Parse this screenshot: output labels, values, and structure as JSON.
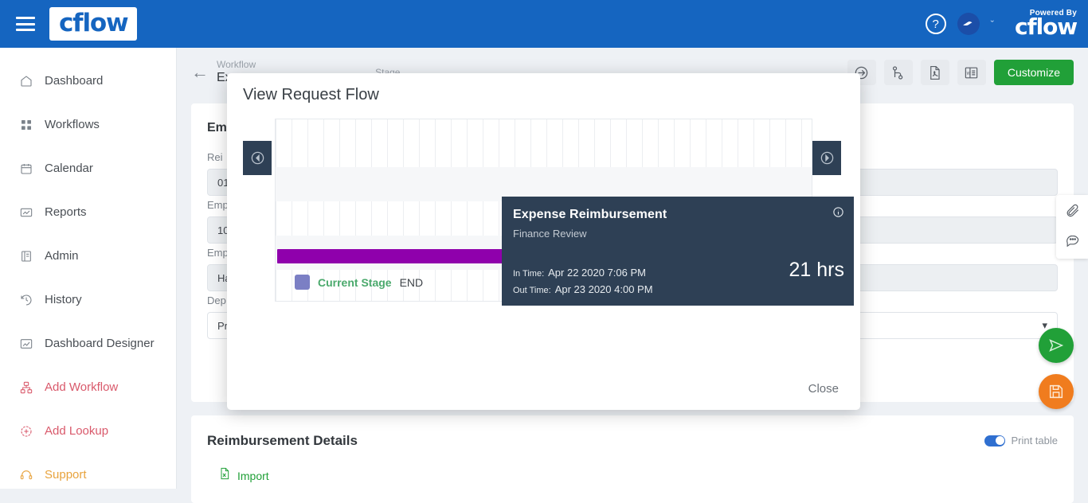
{
  "topbar": {
    "logo_text": "cflow",
    "help_icon": "question-circle-icon",
    "caret": "ˇ",
    "powered_by": "Powered By",
    "powered_logo": "cflow"
  },
  "sidebar": {
    "items": [
      {
        "label": "Dashboard",
        "icon": "home-icon",
        "tone": ""
      },
      {
        "label": "Workflows",
        "icon": "grid-icon",
        "tone": ""
      },
      {
        "label": "Calendar",
        "icon": "calendar-icon",
        "tone": ""
      },
      {
        "label": "Reports",
        "icon": "report-icon",
        "tone": ""
      },
      {
        "label": "Admin",
        "icon": "book-icon",
        "tone": ""
      },
      {
        "label": "History",
        "icon": "clock-history-icon",
        "tone": ""
      },
      {
        "label": "Dashboard Designer",
        "icon": "designer-icon",
        "tone": ""
      },
      {
        "label": "Add Workflow",
        "icon": "add-workflow-icon",
        "tone": "red"
      },
      {
        "label": "Add Lookup",
        "icon": "add-lookup-icon",
        "tone": "red"
      },
      {
        "label": "Support",
        "icon": "headset-icon",
        "tone": "orange"
      }
    ]
  },
  "breadcrumb": {
    "back_icon": "back-arrow-icon",
    "workflow_label": "Workflow",
    "workflow_value": "Exp",
    "stage_label": "Stage",
    "stage_value": ""
  },
  "toolbar": {
    "buttons": [
      {
        "icon": "arrow-in-circle-icon"
      },
      {
        "icon": "branch-icon"
      },
      {
        "icon": "pdf-file-icon"
      },
      {
        "icon": "word-file-icon"
      }
    ],
    "customize_label": "Customize"
  },
  "form": {
    "heading": "Em",
    "fields": [
      {
        "label": "Rei",
        "value": "01"
      },
      {
        "label": "Emp",
        "value": "10"
      },
      {
        "label": "Emp",
        "value": "Ha"
      },
      {
        "label": "Dep",
        "value": "Pro"
      }
    ]
  },
  "bottom_section": {
    "heading": "Reimbursement Details",
    "toggle_label": "Print table",
    "toggle_on": true,
    "import_label": "Import",
    "import_icon": "excel-import-icon"
  },
  "rail": {
    "items": [
      {
        "icon": "paperclip-icon"
      },
      {
        "icon": "comment-icon"
      }
    ],
    "fabs": [
      {
        "icon": "send-icon",
        "color": "#21a038"
      },
      {
        "icon": "save-icon",
        "color": "#f07c1e"
      }
    ]
  },
  "modal": {
    "title": "View Request Flow",
    "close_label": "Close",
    "prev_icon": "arrow-left-circle-icon",
    "next_icon": "arrow-right-circle-icon",
    "tooltip": {
      "title": "Expense Reimbursement",
      "subtitle": "Finance Review",
      "info_icon": "info-circle-icon",
      "in_time_label": "In Time:",
      "in_time_value": "Apr 22 2020 7:06 PM",
      "out_time_label": "Out Time:",
      "out_time_value": "Apr 23 2020 4:00 PM",
      "duration": "21 hrs"
    },
    "legend": {
      "current_stage_label": "Current Stage",
      "current_stage_value": "END",
      "swatch_color": "#7b7fc4"
    }
  },
  "chart_data": {
    "type": "bar",
    "title": "View Request Flow",
    "orientation": "horizontal",
    "categories": [
      "Finance Review"
    ],
    "values": [
      21
    ],
    "value_unit": "hrs",
    "value_labels": [
      "21 hrs"
    ],
    "bar_colors": [
      "#8f00ac"
    ],
    "xlabel": "",
    "ylabel": "",
    "grid": true,
    "legend_position": "inside-bottom",
    "series": [
      {
        "name": "Finance Review",
        "duration_hours": 21,
        "duration_label": "21 hrs",
        "in_time": "Apr 22 2020 7:06 PM",
        "out_time": "Apr 23 2020 4:00 PM",
        "color": "#8f00ac"
      }
    ],
    "annotations": [
      {
        "text": "Current Stage",
        "value": "END"
      }
    ]
  }
}
